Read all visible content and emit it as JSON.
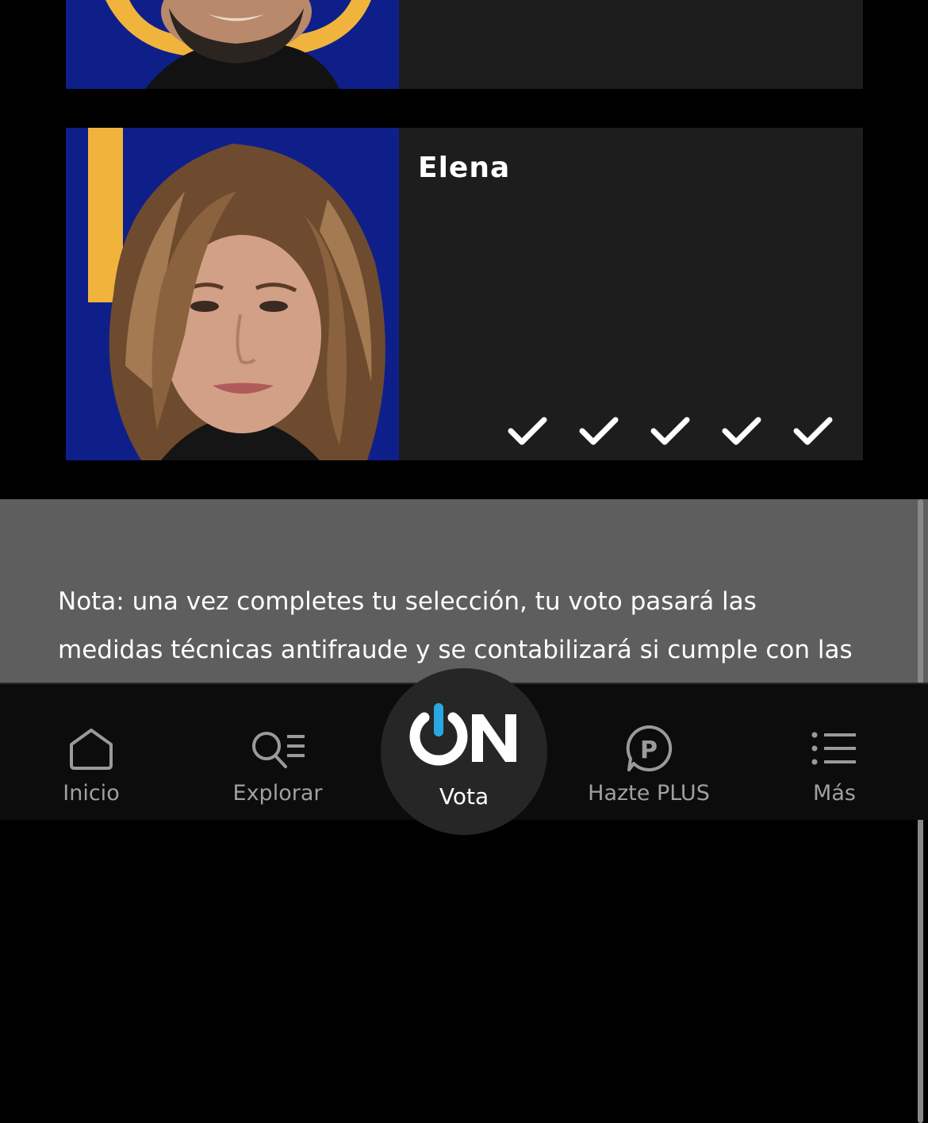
{
  "candidates": [
    {
      "name": "",
      "votes_checked": 0
    },
    {
      "name": "Elena",
      "votes_checked": 5
    }
  ],
  "note": {
    "line1": "Nota: una vez completes tu selección, tu voto pasará las",
    "line2": "medidas técnicas antifraude y se contabilizará si cumple con las"
  },
  "nav": {
    "items": [
      {
        "label": "Inicio",
        "icon": "home-icon"
      },
      {
        "label": "Explorar",
        "icon": "search-list-icon"
      },
      {
        "label": "Vota",
        "icon": "on-logo-icon"
      },
      {
        "label": "Hazte PLUS",
        "icon": "plus-p-icon"
      },
      {
        "label": "Más",
        "icon": "menu-icon"
      }
    ],
    "active": "Vota"
  },
  "colors": {
    "background": "#000000",
    "card": "#1d1d1d",
    "photo_bg": "#0f1f8a",
    "note_bg": "#5e5e5e",
    "nav_bg": "#0c0c0c",
    "accent_blue": "#29a8e0"
  }
}
